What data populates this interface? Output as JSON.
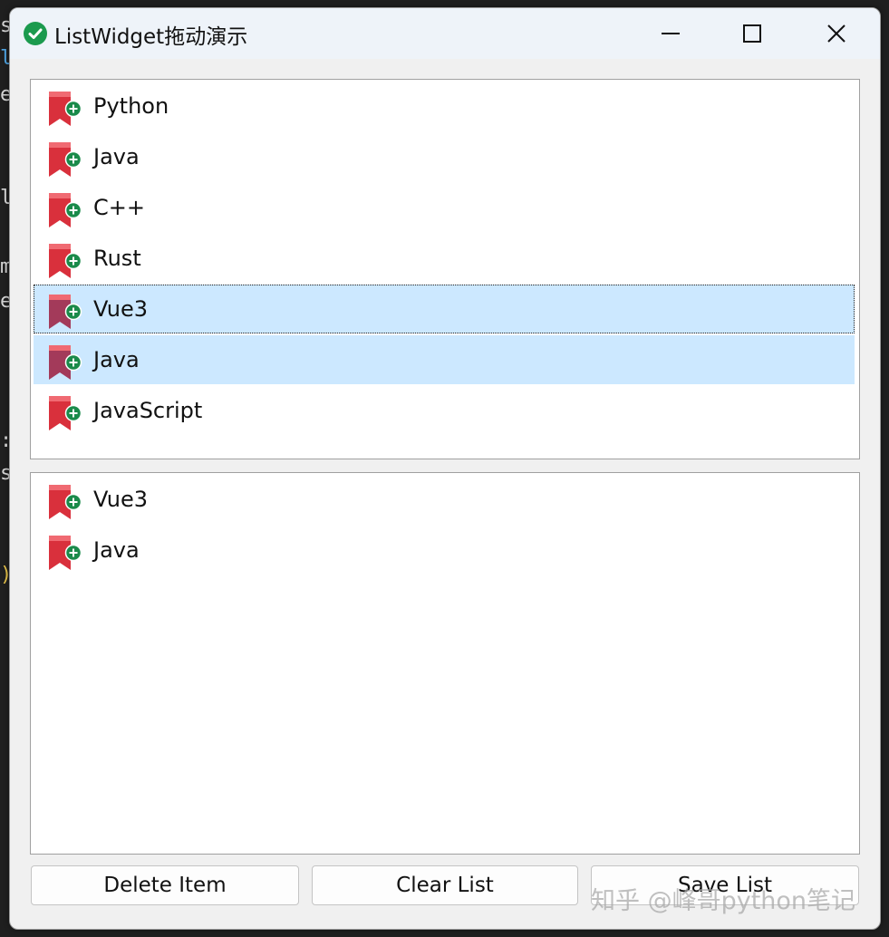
{
  "window": {
    "title": "ListWidget拖动演示"
  },
  "icons": {
    "app": "check-circle-icon",
    "minimize": "minimize-icon",
    "maximize": "maximize-icon",
    "close": "close-icon",
    "item": "bookmark-add-icon"
  },
  "colors": {
    "selection": "#cce8ff",
    "app_icon": "#1b9a4e",
    "item_icon_red": "#d9303c",
    "item_icon_badge": "#1a8a4a"
  },
  "list_top": {
    "items": [
      {
        "label": "Python",
        "selected": false
      },
      {
        "label": "Java",
        "selected": false
      },
      {
        "label": "C++",
        "selected": false
      },
      {
        "label": "Rust",
        "selected": false
      },
      {
        "label": "Vue3",
        "selected": true,
        "focused": true
      },
      {
        "label": "Java",
        "selected": true
      },
      {
        "label": "JavaScript",
        "selected": false
      }
    ]
  },
  "list_bottom": {
    "items": [
      {
        "label": "Vue3"
      },
      {
        "label": "Java"
      }
    ]
  },
  "buttons": {
    "delete": "Delete Item",
    "clear": "Clear List",
    "save": "Save List"
  },
  "background_code": {
    "chars": [
      "s",
      "l",
      "e",
      "l",
      "m",
      "e",
      ":",
      "s",
      ")"
    ]
  },
  "watermark": "知乎 @峰哥python笔记"
}
